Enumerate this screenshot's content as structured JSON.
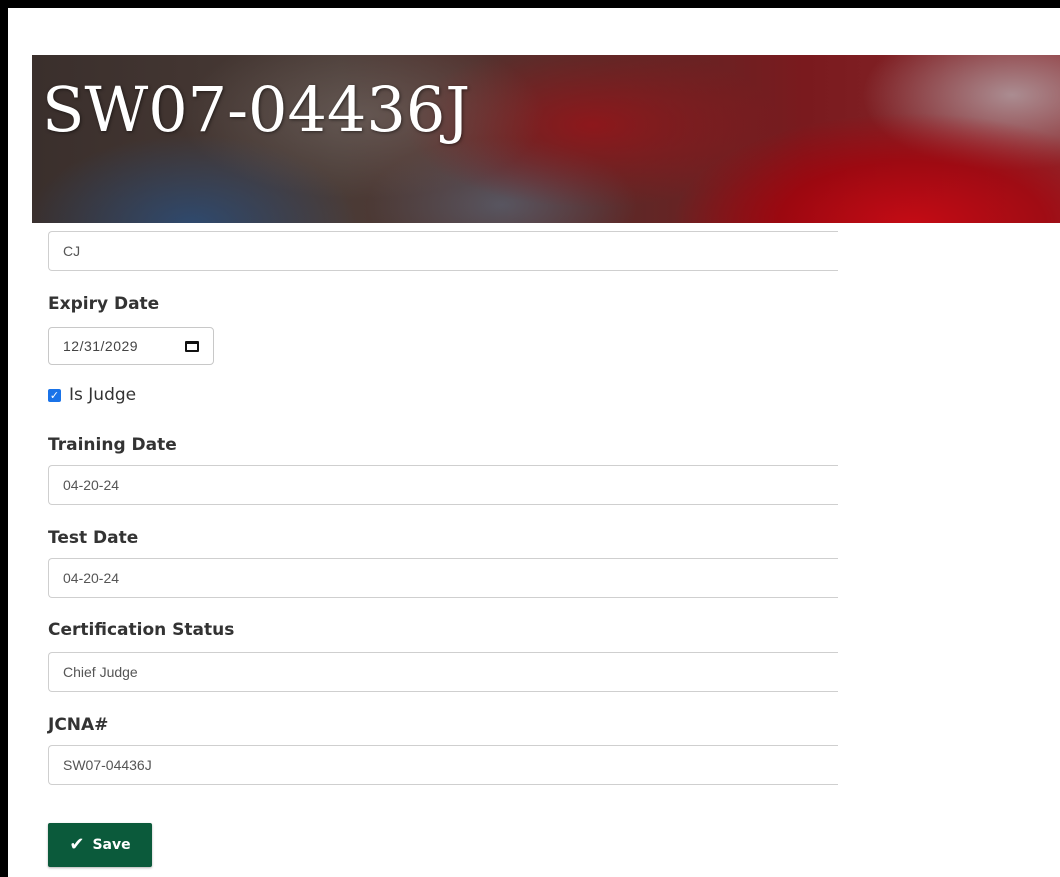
{
  "header": {
    "title": "SW07-04436J"
  },
  "form": {
    "initials_value": "CJ",
    "expiry": {
      "label": "Expiry Date",
      "value": "12/31/2029",
      "icon": "calendar-icon"
    },
    "is_judge": {
      "label": "Is Judge",
      "checked": true
    },
    "training_date": {
      "label": "Training Date",
      "value": "04-20-24"
    },
    "test_date": {
      "label": "Test Date",
      "value": "04-20-24"
    },
    "certification_status": {
      "label": "Certification Status",
      "value": "Chief Judge"
    },
    "jcna": {
      "label": "JCNA#",
      "value": "SW07-04436J"
    },
    "save_label": "Save",
    "save_icon": "checkmark-icon"
  },
  "colors": {
    "save_button": "#0b5a3b",
    "checkbox": "#1a73e8"
  }
}
